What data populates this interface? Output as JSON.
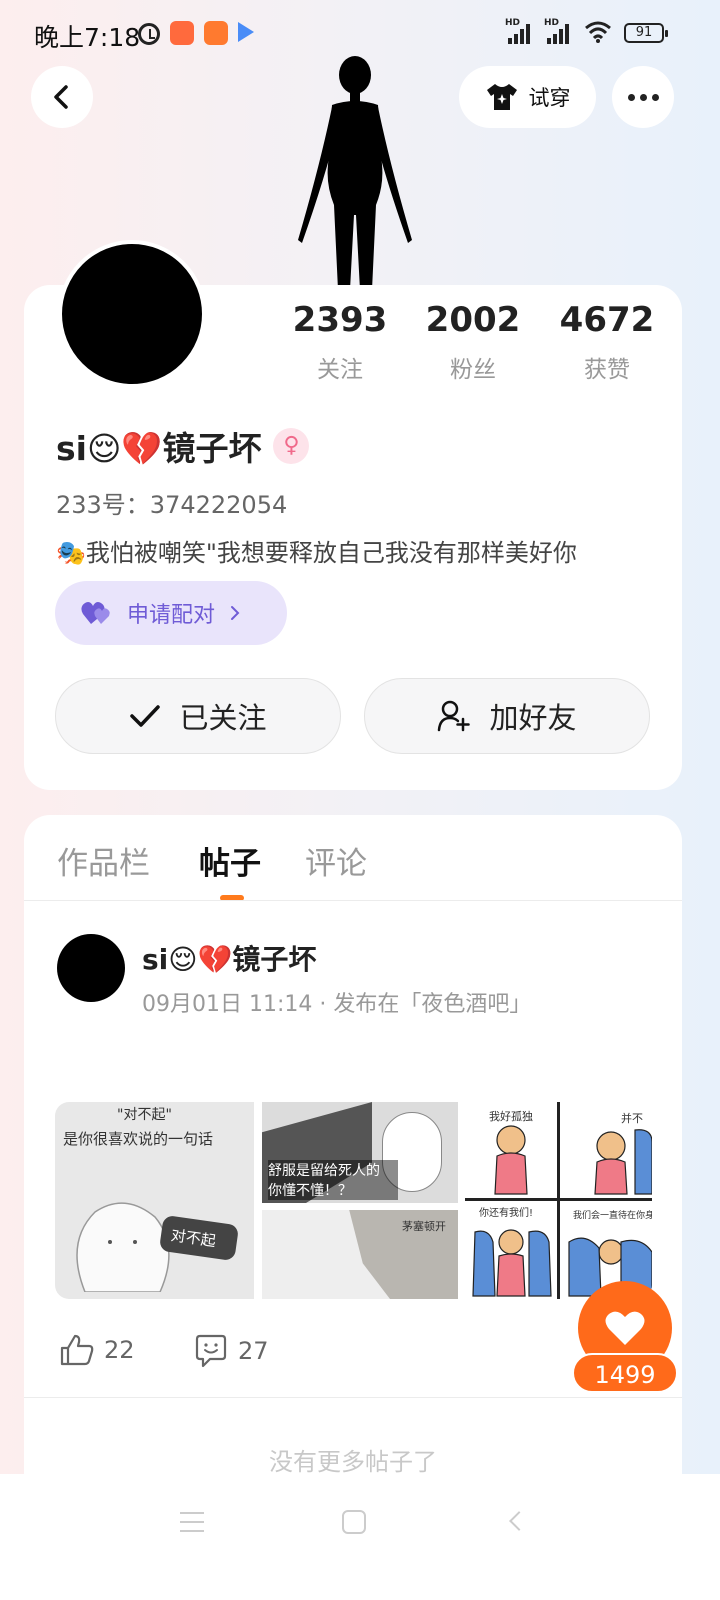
{
  "status_bar": {
    "time": "晚上7:18",
    "battery": "91",
    "hd1": "HD",
    "hd2": "HD"
  },
  "header": {
    "tryon_label": "试穿"
  },
  "profile": {
    "stats": [
      {
        "value": "2393",
        "label": "关注"
      },
      {
        "value": "2002",
        "label": "粉丝"
      },
      {
        "value": "4672",
        "label": "获赞"
      }
    ],
    "username": "si😌💔镜子坏",
    "gender_symbol": "♀",
    "uid": "233号：374222054",
    "bio": "🎭我怕被嘲笑\"我想要释放自己我没有那样美好你",
    "pair_label": "申请配对",
    "follow_label": "已关注",
    "add_friend_label": "加好友"
  },
  "tabs": [
    {
      "label": "作品栏"
    },
    {
      "label": "帖子"
    },
    {
      "label": "评论"
    }
  ],
  "post": {
    "author": "si😌💔镜子坏",
    "meta": "09月01日 11:14 · 发布在「夜色酒吧」",
    "image_texts": {
      "img1_line1": "\"对不起\"",
      "img1_line2": "是你很喜欢说的一句话",
      "img1_bubble": "对不起",
      "img2_caption": "舒服是留给死人的 你懂不懂！？",
      "img3_caption": "茅塞顿开",
      "img4_a": "我好孤独",
      "img4_b": "并不",
      "img4_c": "你还有我们!",
      "img4_d": "我们会一直待在你身边"
    },
    "likes": "22",
    "comments": "27"
  },
  "fab": {
    "count": "1499"
  },
  "footer": {
    "no_more": "没有更多帖子了"
  },
  "colors": {
    "accent": "#ff6a1a",
    "pair_bg": "#e9e4fb",
    "pair_text": "#6f5bd6"
  }
}
